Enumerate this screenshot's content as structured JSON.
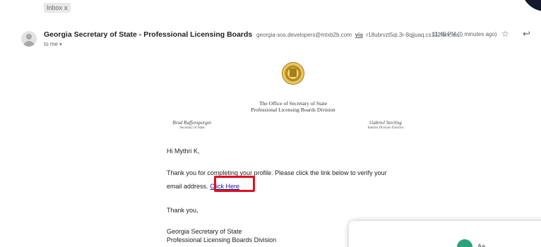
{
  "labels": {
    "inbox": "Inbox",
    "close": "x"
  },
  "email": {
    "sender_name": "Georgia Secretary of State - Professional Licensing Boards",
    "sender_email": "georgia-sos.developers@mtxb2b.com",
    "via": "via",
    "relay": "r18ubrvzt5qi.3r-8qjjuaq.cs132.bnc.sa...",
    "timestamp": "11:40 PM (0 minutes ago)",
    "to": "to me",
    "star_glyph": "☆",
    "reply_glyph": "↩",
    "caret_glyph": "▾"
  },
  "letterhead": {
    "line1": "The Office of Secretary of State",
    "line2": "Professional Licensing Boards Division",
    "left_name": "Brad Raffensperger",
    "left_title": "Secretary of State",
    "right_name": "Gabriel Sterling",
    "right_title": "Interim Division Director"
  },
  "body": {
    "greeting": "Hi Mythri K,",
    "line1": "Thank you for completing your profile. Please click the link below to verify your",
    "line2": "email address.",
    "link": "Click Here",
    "thanks": "Thank you,",
    "sig1": "Georgia Secretary of State",
    "sig2": "Professional Licensing Boards Division"
  },
  "popup": {
    "text": "Aa"
  },
  "colors": {
    "highlight": "#e1101c",
    "link": "#1a0dab",
    "popup_avatar": "#2aa37a"
  }
}
